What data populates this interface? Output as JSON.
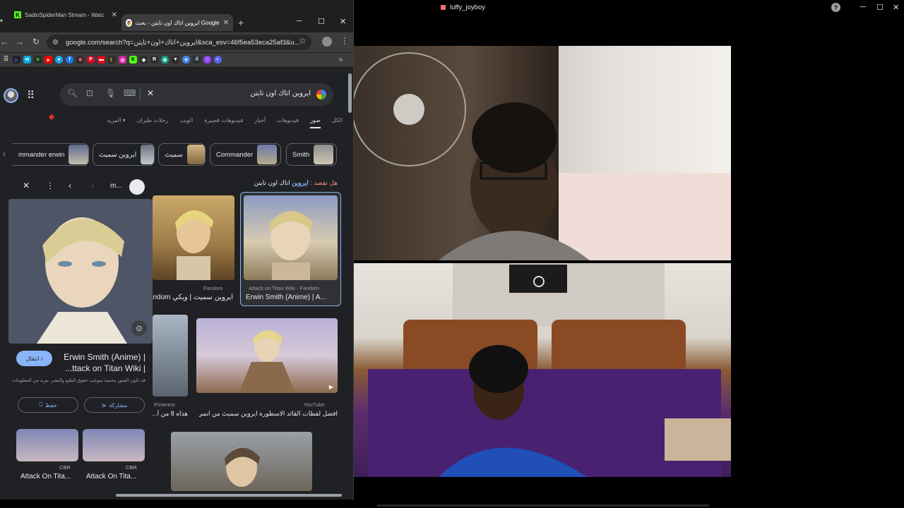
{
  "browser": {
    "tabs": [
      {
        "title": "SadioSpiderMan Stream - Watc",
        "active": false
      },
      {
        "title": "ايروين اتاك اون تايتن - بحث Google",
        "active": true
      }
    ],
    "new_tab": "+",
    "window_controls": {
      "minimize": "─",
      "maximize": "☐",
      "close": "✕"
    },
    "url": "google.com/search?q=ايروين+اتاك+اون+تايتن&sca_esv=46f5ea53eca25af3&u...",
    "bookmarks_more": "»",
    "search": {
      "query": "ايروين اتاك اون تايتن"
    },
    "filters": [
      {
        "label": "الكل",
        "active": false
      },
      {
        "label": "صور",
        "active": true
      },
      {
        "label": "فيديوهات",
        "active": false
      },
      {
        "label": "أخبار",
        "active": false
      },
      {
        "label": "فيديوهات قصيرة",
        "active": false
      },
      {
        "label": "الويب",
        "active": false
      },
      {
        "label": "رحلات طيران",
        "active": false
      },
      {
        "label": "المزيد ▾",
        "active": false
      }
    ],
    "chips": [
      "Smith",
      "Commander",
      "سميث",
      "ايروين سميث",
      "mmander erwin"
    ],
    "did_you_mean": {
      "label": "هل تقصد :",
      "link": "ايروين",
      "rest": "اتاك اون تايتن"
    },
    "preview": {
      "site_abbrev": "m...",
      "title": "Erwin Smith (Anime) |\n...ttack on Titan Wiki |",
      "visit": "انتقال ›",
      "note": "قد تكون الصور محمية بموجب حقوق الطبع والنشر. مزيد من المعلومات",
      "share": "مشاركة",
      "save": "حفظ",
      "related": [
        {
          "source": "CBR",
          "title": "Attack On Tita..."
        },
        {
          "source": "CBR",
          "title": "Attack On Tita..."
        }
      ]
    },
    "results": [
      {
        "source": "Attack on Titan Wiki - Fandom",
        "title": "Erwin Smith (Anime) | A..."
      },
      {
        "source": "Fandom",
        "title": "ايروين سميث | ويكي Fandom"
      },
      {
        "source": "YouTube",
        "title": "افضل لقطات القائد الاسطورة ايروين سميث من انمي ..."
      },
      {
        "source": "Pinterest",
        "title": "هذاه 8 من أ..."
      }
    ]
  },
  "call": {
    "title": "luffy_joyboy",
    "help": "?",
    "window_controls": {
      "minimize": "─",
      "maximize": "☐",
      "close": "✕"
    }
  },
  "colors": {
    "accent": "#8ab4f8",
    "youtube": "#ff0000",
    "kick": "#53fc18"
  }
}
